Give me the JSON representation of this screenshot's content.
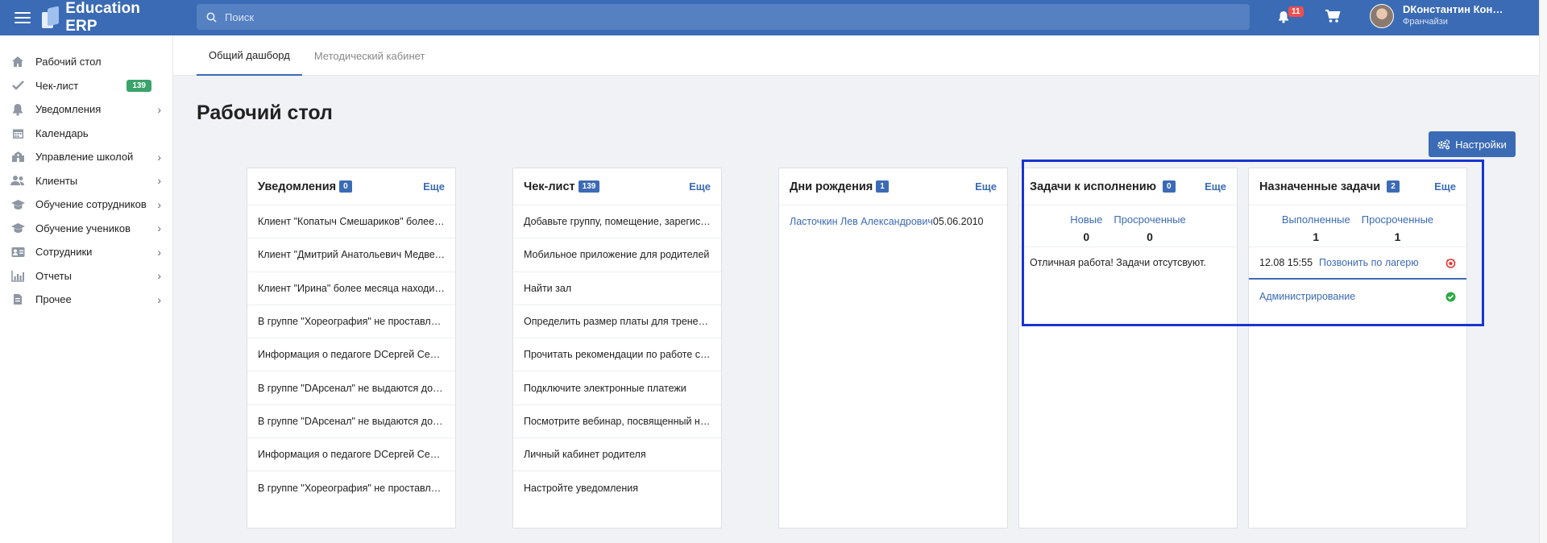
{
  "app": {
    "title": "Education ERP"
  },
  "search": {
    "placeholder": "Поиск"
  },
  "header": {
    "notifications_count": "11",
    "user_name": "DКонстантин Кон…",
    "user_role": "Франчайзи"
  },
  "sidebar": {
    "items": [
      {
        "label": "Рабочий стол",
        "icon": "home-icon"
      },
      {
        "label": "Чек-лист",
        "icon": "check-icon",
        "badge": "139"
      },
      {
        "label": "Уведомления",
        "icon": "bell-icon"
      },
      {
        "label": "Календарь",
        "icon": "calendar-icon"
      },
      {
        "label": "Управление школой",
        "icon": "school-icon"
      },
      {
        "label": "Клиенты",
        "icon": "clients-icon"
      },
      {
        "label": "Обучение сотрудников",
        "icon": "staff-training-icon"
      },
      {
        "label": "Обучение учеников",
        "icon": "students-training-icon"
      },
      {
        "label": "Сотрудники",
        "icon": "employees-icon"
      },
      {
        "label": "Отчеты",
        "icon": "reports-icon"
      },
      {
        "label": "Прочее",
        "icon": "other-icon"
      }
    ]
  },
  "tabs": [
    {
      "label": "Общий дашборд"
    },
    {
      "label": "Методический кабинет"
    }
  ],
  "page": {
    "title": "Рабочий стол",
    "settings_label": "Настройки"
  },
  "cards": {
    "notifications": {
      "title": "Уведомления",
      "count": "0",
      "more": "Еще",
      "items": [
        "Клиент \"Копатыч Смешариков\" более месяц…",
        "Клиент \"Дмитрий Анатольевич Медведев\" б…",
        "Клиент \"Ирина\" более месяца находится в с…",
        "В группе \"Хореография\" не проставляются о…",
        "Информация о педагоге DСергей Сергеич С…",
        "В группе \"DАрсенал\" не выдаются домашни…",
        "В группе \"DАрсенал\" не выдаются домашни…",
        "Информация о педагоге DСергей Сергеич С…",
        "В группе \"Хореография\" не проставляются о…"
      ]
    },
    "checklist": {
      "title": "Чек-лист",
      "count": "139",
      "more": "Еще",
      "items": [
        "Добавьте группу, помещение, зарегистриру…",
        "Мобильное приложение для родителей",
        "Найти зал",
        "Определить размер платы для тренерского …",
        "Прочитать рекомендации по работе с детьм…",
        "Подключите электронные платежи",
        "Посмотрите вебинар, посвященный несчаст…",
        "Личный кабинет родителя",
        "Настройте уведомления"
      ]
    },
    "birthdays": {
      "title": "Дни рождения",
      "count": "1",
      "more": "Еще",
      "items": [
        {
          "name": "Ласточкин Лев Александрович",
          "date": "05.06.2010"
        }
      ]
    },
    "tasks": {
      "title": "Задачи к исполнению",
      "count": "0",
      "more": "Еще",
      "new_label": "Новые",
      "new_value": "0",
      "overdue_label": "Просроченные",
      "overdue_value": "0",
      "empty": "Отличная работа! Задачи отсутсвуют."
    },
    "assigned": {
      "title": "Назначенные задачи",
      "count": "2",
      "more": "Еще",
      "done_label": "Выполненные",
      "done_value": "1",
      "overdue_label": "Просроченные",
      "overdue_value": "1",
      "task_time": "12.08 15:55",
      "task_link": "Позвонить по лагерю",
      "task2_link": "Администрирование"
    }
  },
  "colors": {
    "primary": "#3b6bb5",
    "success": "#3aa36b",
    "danger": "#f04e4e",
    "highlight": "#1834d0"
  }
}
